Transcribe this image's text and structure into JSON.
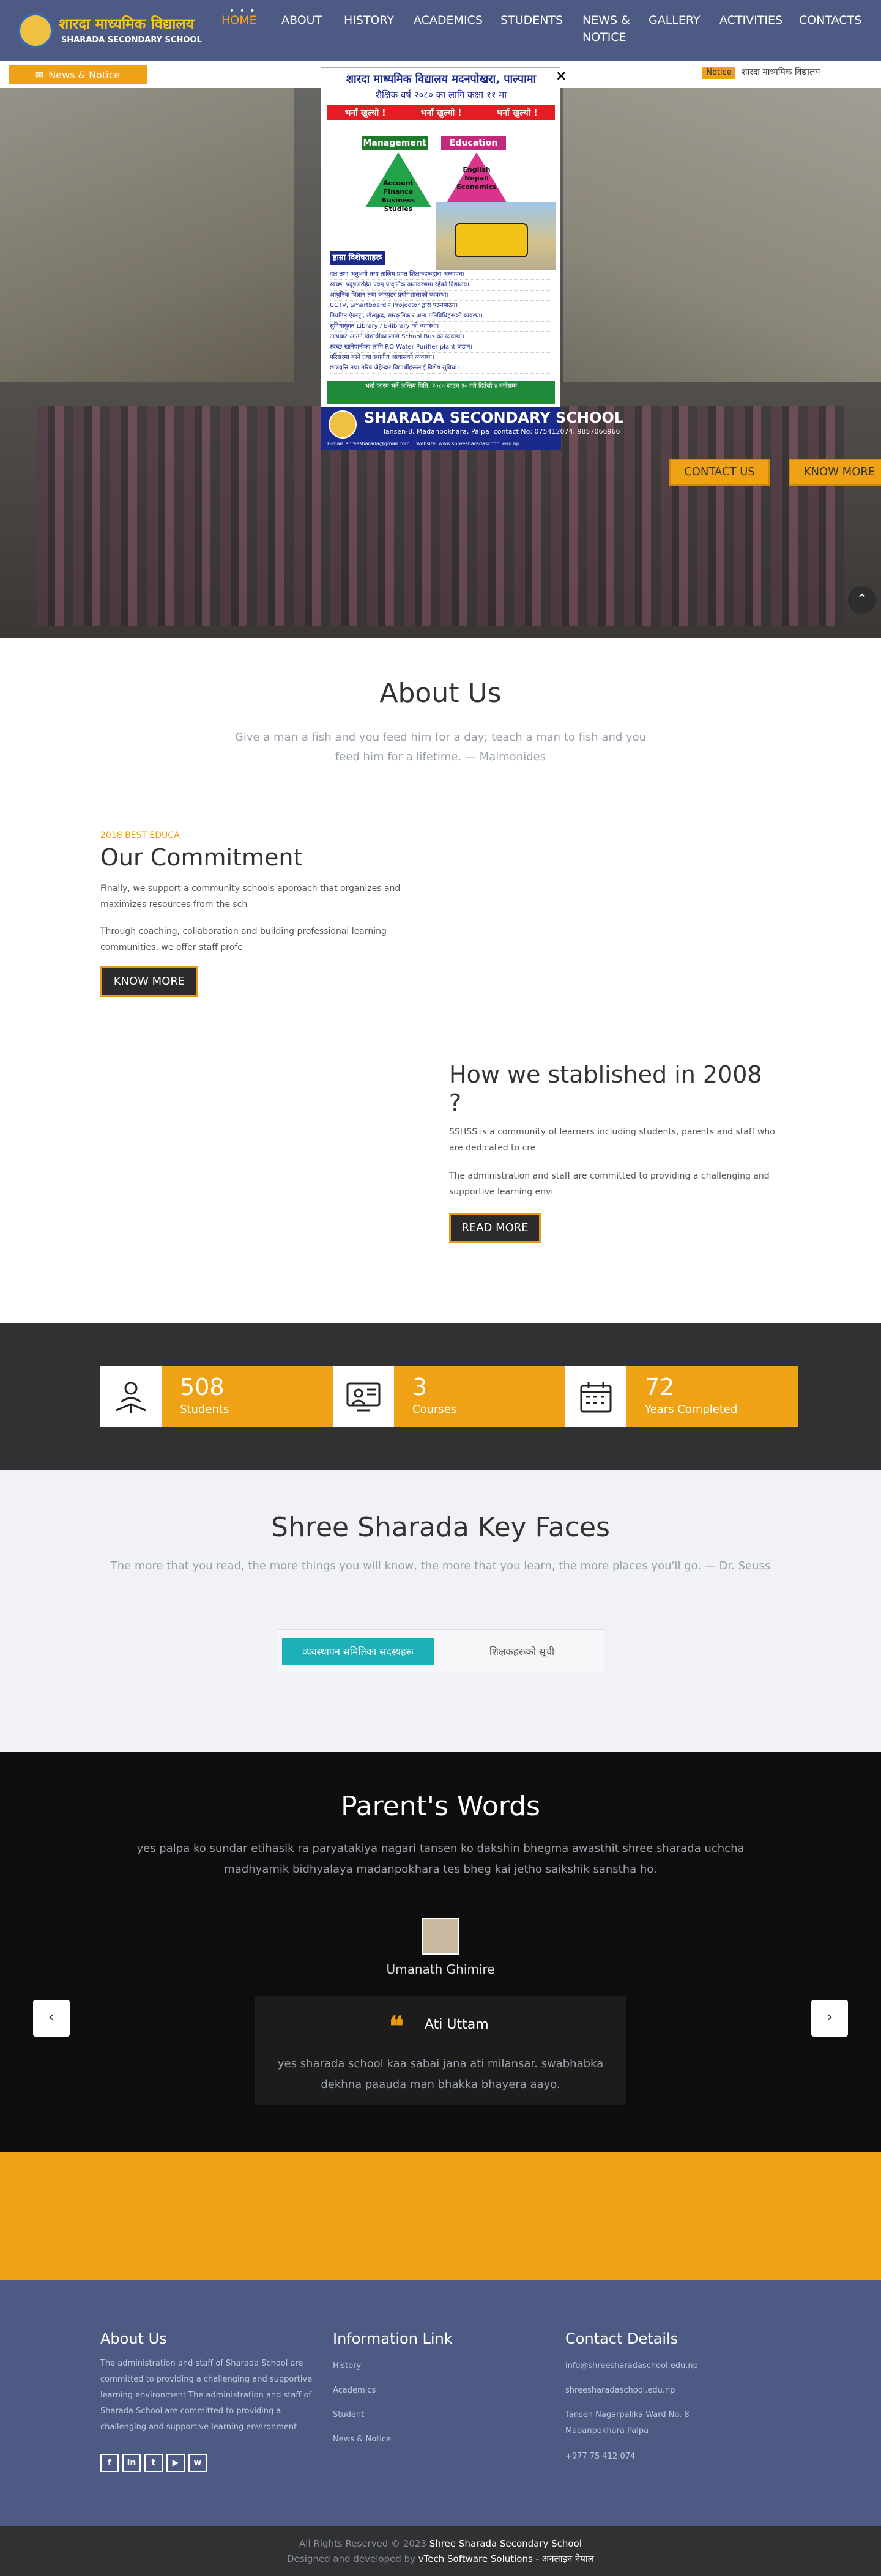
{
  "header": {
    "logo_np": "शारदा माध्यमिक विद्यालय",
    "logo_en": "SHARADA SECONDARY SCHOOL",
    "nav": [
      {
        "label": "HOME"
      },
      {
        "label": "ABOUT"
      },
      {
        "label": "HISTORY"
      },
      {
        "label": "ACADEMICS"
      },
      {
        "label": "STUDENTS"
      },
      {
        "label": "NEWS &"
      },
      {
        "label": "NOTICE"
      },
      {
        "label": "GALLERY"
      },
      {
        "label": "ACTIVITIES"
      },
      {
        "label": "CONTACTS"
      }
    ],
    "active_color": "#f5a51c",
    "bg_color": "#4d5a84"
  },
  "news_bar": {
    "button_label": "News & Notice",
    "notice_tag": "Notice",
    "notice_text": "शारदा माध्यमिक विद्यालय"
  },
  "popup": {
    "close": "×",
    "title": "शारदा माध्यमिक विद्यालय मदनपोखरा, पाल्पामा",
    "subtitle": "शैक्षिक वर्ष २०८० का लागि कक्षा ११ मा",
    "admission": [
      "भर्ना खुल्यो !",
      "भर्ना खुल्यो !",
      "भर्ना खुल्यो !"
    ],
    "streams": [
      {
        "name": "Management",
        "subjects": "Account Finance Business Studies"
      },
      {
        "name": "Education",
        "subjects": "English Nepali Economics"
      }
    ],
    "features_title": "हाम्रा विशेषताहरू",
    "features": [
      "दक्ष तथा अनुभवी तथा तालिम प्राप्त शिक्षकहरूद्वारा अध्यापन।",
      "स्वच्छ, प्रदूषणरहित एवम् प्राकृतिक वातावरणमा रहेको विद्यालय।",
      "आधुनिक विज्ञान तथा कम्प्युटर प्रयोगशालाको व्यवस्था।",
      "CCTV, Smartboard र Projector द्वारा पठनपाठन।",
      "नियमित ऐक्स्ट्रा, खेलकुद, सांस्कृतिक र अन्य गतिविधिहरूको व्यवस्था।",
      "सुविधायुक्त Library / E-library को व्यवस्था।",
      "टाढाबाट आउने विद्यार्थीका लागि School Bus को व्यवस्था।",
      "स्वच्छ खानेपानीका लागि RO Water Purifier plant जडान।",
      "परिसरमा बस्ने तथा स्थानीय आवासको व्यवस्था।",
      "छात्रवृत्ति तथा गरिब जेहेन्दार विद्यार्थीहरूलाई विशेष सुविधा।"
    ],
    "footer_notice": "भर्ना फारम भर्ने अन्तिम मिति: २०८० साउन ३० गते दिउँसो ४ बजेसम्म",
    "school_name": "SHARADA SECONDARY SCHOOL",
    "address": "Tansen-8, Madanpokhara, Palpa",
    "contact": "contact No: 075412074, 9857066966",
    "email": "E-mail: shreesharada@gmail.com",
    "website": "Website: www.shreesharadaschool.edu.np"
  },
  "hero": {
    "contact_button": "CONTACT US",
    "know_button": "KNOW MORE",
    "scroll_top_icon": "chevron-up-icon"
  },
  "about": {
    "title": "About Us",
    "quote": "Give a man a fish and you feed him for a day; teach a man to fish and you feed him for a lifetime. — Maimonides"
  },
  "commitment": {
    "small": "2018 BEST EDUCA",
    "title": "Our Commitment",
    "p1": "Finally, we support a community schools approach that organizes and maximizes resources from the sch",
    "p2": "Through coaching, collaboration and building professional learning communities, we offer staff profe",
    "button": "KNOW MORE"
  },
  "established": {
    "title": "How we stablished in 2008 ?",
    "p1": "SSHSS is a community of learners including students, parents and staff who are dedicated to cre",
    "p2": "The administration and staff are committed to providing a challenging and supportive learning envi",
    "button": "READ MORE"
  },
  "stats": [
    {
      "number": "508",
      "label": "Students",
      "icon": "teacher-book-icon"
    },
    {
      "number": "3",
      "label": "Courses",
      "icon": "online-class-icon"
    },
    {
      "number": "72",
      "label": "Years Completed",
      "icon": "calendar-icon"
    }
  ],
  "faces": {
    "title": "Shree Sharada Key Faces",
    "quote": "The more that you read, the more things you will know, the more that you learn, the more places you'll go. — Dr. Seuss",
    "tab_active": "व्यवस्थापन समितिका सदस्यहरू",
    "tab_inactive": "शिक्षकहरूको सूची"
  },
  "parents": {
    "title": "Parent's Words",
    "description": "yes palpa ko sundar etihasik ra paryatakiya nagari tansen ko dakshin bhegma awasthit shree sharada uchcha madhyamik bidhyalaya madanpokhara tes bheg kai jetho saikshik sanstha ho.",
    "name": "Umanath Ghimire",
    "card_title": "Ati Uttam",
    "card_text": "yes sharada school kaa sabai jana ati milansar. swabhabka dekhna paauda man bhakka bhayera aayo.",
    "prev": "‹",
    "next": "›"
  },
  "footer": {
    "about_title": "About Us",
    "about_text": "The administration and staff of Sharada School are committed to providing a challenging and supportive learning environment The administration and staff of Sharada School are committed to providing a challenging and supportive learning environment",
    "links_title": "Information Link",
    "links": [
      "History",
      "Academics",
      "Student",
      "News & Notice"
    ],
    "contact_title": "Contact Details",
    "contacts": [
      "info@shreesharadaschool.edu.np",
      "shreesharadaschool.edu.np",
      "Tansen Nagarpalika Ward No. 8 - Madanpokhara Palpa",
      "+977 75 412 074"
    ],
    "social": [
      "f",
      "in",
      "t",
      "▶",
      "w"
    ]
  },
  "copyright": {
    "line1_prefix": "All Rights Reserved © 2023 ",
    "line1_name": "Shree Sharada Secondary School",
    "line2_prefix": "Designed and developed by ",
    "line2_name": "vTech Software Solutions - अनलाइन नेपाल"
  }
}
